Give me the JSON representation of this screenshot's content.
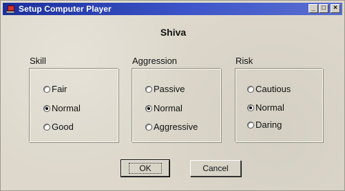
{
  "window": {
    "title": "Setup Computer Player",
    "minimize_glyph": "_",
    "maximize_glyph": "□",
    "close_glyph": "×"
  },
  "player_name": "Shiva",
  "groups": {
    "skill": {
      "label": "Skill",
      "options": [
        "Fair",
        "Normal",
        "Good"
      ],
      "selected": "Normal"
    },
    "aggression": {
      "label": "Aggression",
      "options": [
        "Passive",
        "Normal",
        "Aggressive"
      ],
      "selected": "Normal"
    },
    "risk": {
      "label": "Risk",
      "options": [
        "Cautious",
        "Normal",
        "Daring"
      ],
      "selected": "Normal"
    }
  },
  "buttons": {
    "ok_label": "OK",
    "cancel_label": "Cancel"
  }
}
